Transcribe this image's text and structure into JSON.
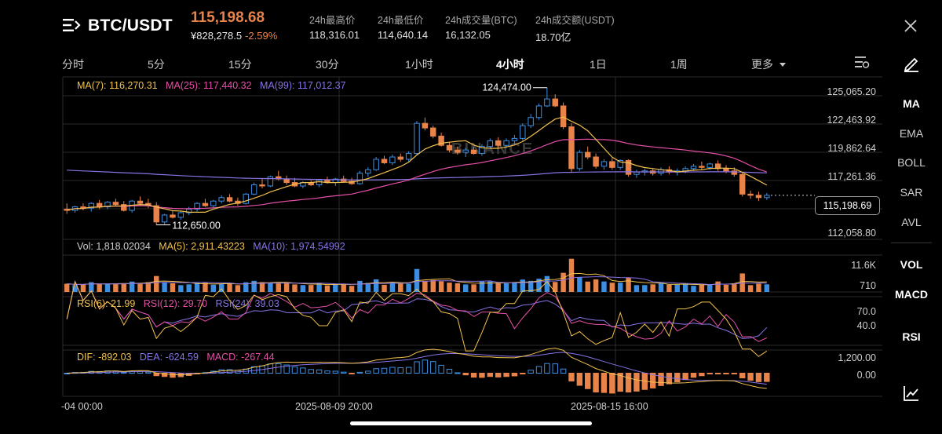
{
  "header": {
    "pair": "BTC/USDT",
    "last_price": "115,198.68",
    "cny_price": "¥828,278.5",
    "change": "-2.59%",
    "stats": [
      {
        "label": "24h最高价",
        "value": "118,316.01"
      },
      {
        "label": "24h最低价",
        "value": "114,640.14"
      },
      {
        "label": "24h成交量(BTC)",
        "value": "16,132.05"
      },
      {
        "label": "24h成交额(USDT)",
        "value": "18.70亿"
      }
    ]
  },
  "tabs": [
    {
      "label": "分时"
    },
    {
      "label": "5分"
    },
    {
      "label": "15分"
    },
    {
      "label": "30分"
    },
    {
      "label": "1小时"
    },
    {
      "label": "4小时"
    },
    {
      "label": "1日"
    },
    {
      "label": "1周"
    },
    {
      "label": "更多"
    }
  ],
  "active_tab": "4小时",
  "ma_legend": {
    "ma7": "MA(7): 116,270.31",
    "ma25": "MA(25): 117,440.32",
    "ma99": "MA(99): 117,012.37"
  },
  "vol_legend": {
    "vol": "Vol: 1,818.02034",
    "ma5": "MA(5): 2,911.43223",
    "ma10": "MA(10): 1,974.54992"
  },
  "rsi_legend": {
    "rsi6": "RSI(6): 21.99",
    "rsi12": "RSI(12): 29.70",
    "rsi24": "RSI(24): 39.03"
  },
  "macd_legend": {
    "dif": "DIF: -892.03",
    "dea": "DEA: -624.59",
    "macd": "MACD: -267.44"
  },
  "price_axis": [
    "125,065.20",
    "122,463.92",
    "119,862.64",
    "117,261.36",
    "112,058.80"
  ],
  "current_price_tag": "115,198.69",
  "high_marker": "124,474.00",
  "low_marker": "112,650.00",
  "watermark": "BINANCE",
  "vol_axis": [
    "11.6K",
    "710"
  ],
  "rsi_axis": [
    "70.0",
    "40.0"
  ],
  "macd_axis": [
    "1,200.00",
    "0.00"
  ],
  "time_axis": [
    "-04 00:00",
    "2025-08-09 20:00",
    "2025-08-15 16:00"
  ],
  "side_indicators": [
    "MA",
    "EMA",
    "BOLL",
    "SAR",
    "AVL",
    "VOL",
    "MACD",
    "RSI"
  ],
  "colors": {
    "up": "#3d8fe3",
    "down": "#e8834a",
    "ma7": "#f2c14e",
    "ma25": "#e64fa8",
    "ma99": "#8a73e6",
    "grid": "#2a2a2a"
  },
  "chart_data": {
    "type": "candlestick",
    "interval": "4小时",
    "price_ylim": [
      111400,
      125400
    ],
    "highest_marker": 124474.0,
    "lowest_marker": 112650.0,
    "last_price": 115198.69,
    "candles_ohlc": [
      [
        114000,
        114500,
        113600,
        113900
      ],
      [
        113900,
        114300,
        113700,
        114200
      ],
      [
        114200,
        114500,
        113900,
        114100
      ],
      [
        114100,
        114600,
        113800,
        114500
      ],
      [
        114500,
        114800,
        114000,
        114200
      ],
      [
        114200,
        114700,
        114000,
        114600
      ],
      [
        114600,
        114900,
        114300,
        114400
      ],
      [
        114400,
        114700,
        113800,
        113900
      ],
      [
        113900,
        114800,
        113700,
        114700
      ],
      [
        114700,
        115100,
        114300,
        114500
      ],
      [
        114500,
        114900,
        114100,
        114300
      ],
      [
        114300,
        114600,
        112650,
        112900
      ],
      [
        112900,
        113600,
        112700,
        113500
      ],
      [
        113500,
        113900,
        113200,
        113300
      ],
      [
        113300,
        113800,
        113100,
        113700
      ],
      [
        113700,
        114200,
        113500,
        114000
      ],
      [
        114000,
        114600,
        113800,
        114500
      ],
      [
        114500,
        114900,
        114200,
        114300
      ],
      [
        114300,
        114800,
        114100,
        114700
      ],
      [
        114700,
        115200,
        114500,
        115000
      ],
      [
        115000,
        115300,
        114600,
        114700
      ],
      [
        114700,
        115000,
        114300,
        114500
      ],
      [
        114500,
        115400,
        114400,
        115300
      ],
      [
        115300,
        116300,
        115200,
        116100
      ],
      [
        116100,
        116600,
        115800,
        116000
      ],
      [
        116000,
        116900,
        115900,
        116800
      ],
      [
        116800,
        117300,
        116500,
        116600
      ],
      [
        116600,
        116900,
        116100,
        116300
      ],
      [
        116300,
        116700,
        115900,
        116000
      ],
      [
        116000,
        116400,
        115800,
        116300
      ],
      [
        116300,
        116500,
        116000,
        116100
      ],
      [
        116100,
        116600,
        115900,
        116500
      ],
      [
        116500,
        116800,
        116200,
        116300
      ],
      [
        116300,
        116700,
        116000,
        116600
      ],
      [
        116600,
        116900,
        116300,
        116400
      ],
      [
        116400,
        116700,
        116100,
        116200
      ],
      [
        116200,
        117300,
        116100,
        117100
      ],
      [
        117100,
        117600,
        116800,
        117400
      ],
      [
        117400,
        118500,
        117300,
        118300
      ],
      [
        118300,
        118600,
        117900,
        118000
      ],
      [
        118000,
        118700,
        117800,
        118500
      ],
      [
        118500,
        118800,
        118100,
        118300
      ],
      [
        118300,
        119000,
        118100,
        118800
      ],
      [
        118800,
        121600,
        118700,
        121400
      ],
      [
        121400,
        121900,
        120800,
        121000
      ],
      [
        121000,
        121200,
        120100,
        120300
      ],
      [
        120300,
        120600,
        119400,
        119500
      ],
      [
        119500,
        119800,
        118900,
        119100
      ],
      [
        119100,
        119400,
        118700,
        118900
      ],
      [
        118900,
        119300,
        118500,
        119100
      ],
      [
        119100,
        119400,
        118700,
        118800
      ],
      [
        118800,
        119600,
        118600,
        119400
      ],
      [
        119400,
        120100,
        119200,
        119900
      ],
      [
        119900,
        120200,
        119300,
        119500
      ],
      [
        119500,
        120100,
        119300,
        119900
      ],
      [
        119900,
        120400,
        119600,
        120100
      ],
      [
        120100,
        121400,
        119900,
        121200
      ],
      [
        121200,
        122200,
        121000,
        121900
      ],
      [
        121900,
        123100,
        121700,
        122900
      ],
      [
        122900,
        124474,
        122800,
        123500
      ],
      [
        123500,
        123900,
        122800,
        122900
      ],
      [
        122900,
        123200,
        120900,
        121100
      ],
      [
        121100,
        121400,
        117200,
        117500
      ],
      [
        117500,
        119100,
        117300,
        118900
      ],
      [
        118900,
        119400,
        118300,
        118500
      ],
      [
        118500,
        118800,
        117500,
        117700
      ],
      [
        117700,
        118300,
        117400,
        118100
      ],
      [
        118100,
        118400,
        117400,
        117600
      ],
      [
        117600,
        118300,
        117400,
        118200
      ],
      [
        118200,
        118300,
        116800,
        117000
      ],
      [
        117000,
        117400,
        116700,
        117200
      ],
      [
        117200,
        117500,
        116900,
        117300
      ],
      [
        117300,
        117500,
        116900,
        117100
      ],
      [
        117100,
        117600,
        116900,
        117400
      ],
      [
        117400,
        117700,
        117000,
        117200
      ],
      [
        117200,
        117500,
        116900,
        117300
      ],
      [
        117300,
        117700,
        117100,
        117500
      ],
      [
        117500,
        117900,
        117300,
        117700
      ],
      [
        117700,
        118100,
        117400,
        117600
      ],
      [
        117600,
        118000,
        117400,
        117900
      ],
      [
        117900,
        118200,
        117300,
        117500
      ],
      [
        117500,
        117800,
        117100,
        117300
      ],
      [
        117300,
        117600,
        116800,
        117000
      ],
      [
        117000,
        117200,
        115100,
        115300
      ],
      [
        115300,
        115600,
        114900,
        115200
      ],
      [
        115200,
        115500,
        114700,
        115000
      ],
      [
        115000,
        115400,
        114800,
        115199
      ]
    ],
    "ma_lines_note": "MA(7), MA(25), MA(99) computed from candle closes",
    "volume_ylim": [
      0,
      11600
    ],
    "rsi_ylim": [
      15,
      80
    ],
    "macd_ylim": [
      -1300,
      1300
    ],
    "time_labels": [
      "-04 00:00",
      "2025-08-09 20:00",
      "2025-08-15 16:00"
    ]
  }
}
